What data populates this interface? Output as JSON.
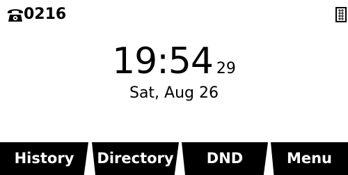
{
  "status_bar": {
    "phone_icon": "phone-icon",
    "account": "0216",
    "network_icon": "network-icon"
  },
  "clock": {
    "time": "19:54",
    "seconds": "29"
  },
  "date": "Sat, Aug 26",
  "softkeys": [
    {
      "label": "History"
    },
    {
      "label": "Directory"
    },
    {
      "label": "DND"
    },
    {
      "label": "Menu"
    }
  ],
  "colors": {
    "background": "#ffffff",
    "text": "#000000",
    "softkey_bg": "#000000",
    "softkey_text": "#ffffff"
  }
}
